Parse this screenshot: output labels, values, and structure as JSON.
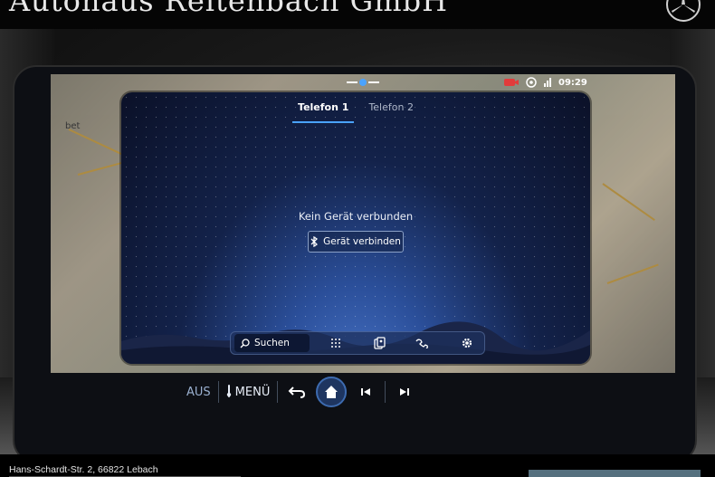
{
  "banner": {
    "title": "Autohaus Reitenbach GmbH",
    "logo": "mercedes-star-icon"
  },
  "status_bar": {
    "time": "09:29",
    "icons": [
      "camera-connection-icon",
      "message-icon",
      "signal-icon"
    ]
  },
  "map": {
    "labels": [
      "bet"
    ]
  },
  "phone": {
    "tabs": [
      {
        "label": "Telefon 1",
        "active": true
      },
      {
        "label": "Telefon 2",
        "active": false
      }
    ],
    "message": "Kein Gerät verbunden",
    "connect_button": "Gerät verbinden",
    "toolbar": {
      "search_label": "Suchen",
      "icons": [
        "keypad-icon",
        "contacts-icon",
        "call-log-icon",
        "settings-icon"
      ]
    }
  },
  "controls": {
    "off_label": "AUS",
    "menu_label": "MENÜ",
    "icons": [
      "back-icon",
      "home-icon",
      "previous-track-icon",
      "next-track-icon"
    ]
  },
  "footer": {
    "address": "Hans-Schardt-Str. 2, 66822 Lebach"
  },
  "colors": {
    "accent": "#4aa3ff",
    "screen_blue": "#13224a",
    "footer_button": "#55707e"
  }
}
